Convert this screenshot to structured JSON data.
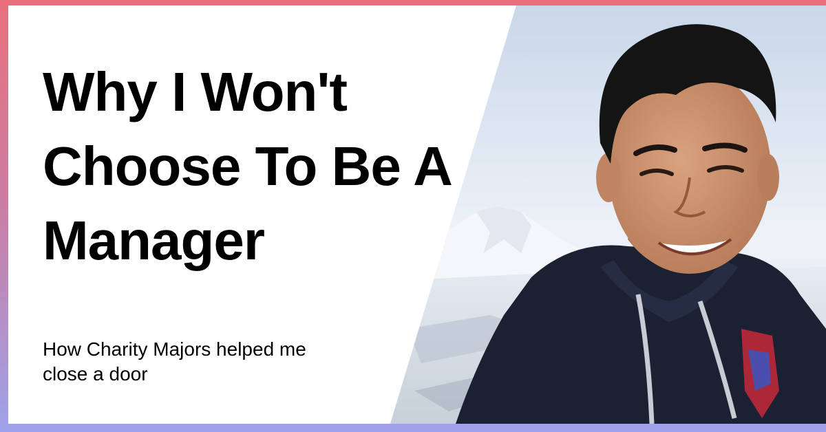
{
  "headline": {
    "line1": "Why I Won't",
    "line2": "Choose To Be A",
    "line3": "Manager"
  },
  "subtitle": {
    "line1": "How Charity Majors helped me",
    "line2": "close a door"
  },
  "photo": {
    "subject": "portrait-photo"
  },
  "colors": {
    "border_top": "#e9707c",
    "border_bottom": "#9fa2ea",
    "card_background": "#ffffff",
    "text": "#000000",
    "sky": "#dfe7f1",
    "hoodie": "#1b2033"
  }
}
